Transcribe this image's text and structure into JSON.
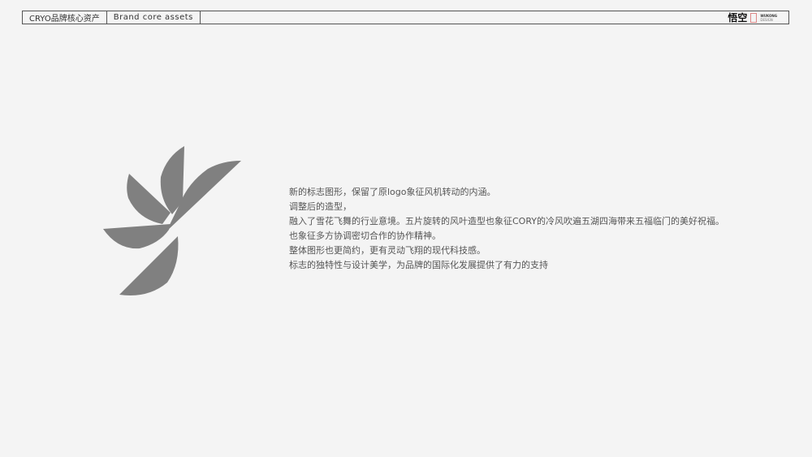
{
  "header": {
    "title_cn": "CRYO品牌核心资产",
    "title_en": "Brand core assets",
    "brand_logo_cn": "悟空",
    "brand_logo_en": "WUKONG",
    "brand_logo_sub": "DESIGN"
  },
  "logo": {
    "color": "#808080",
    "icon": "windmill-leaf-logo"
  },
  "description": [
    "新的标志图形，保留了原logo象征风机转动的内涵。",
    "调整后的造型，",
    "融入了雪花飞舞的行业意境。五片旋转的风叶造型也象征CORY的冷风吹遍五湖四海带来五福临门的美好祝福。",
    "也象征多方协调密切合作的协作精神。",
    "整体图形也更简约，更有灵动飞翔的现代科技感。",
    "标志的独特性与设计美学，为品牌的国际化发展提供了有力的支持"
  ]
}
